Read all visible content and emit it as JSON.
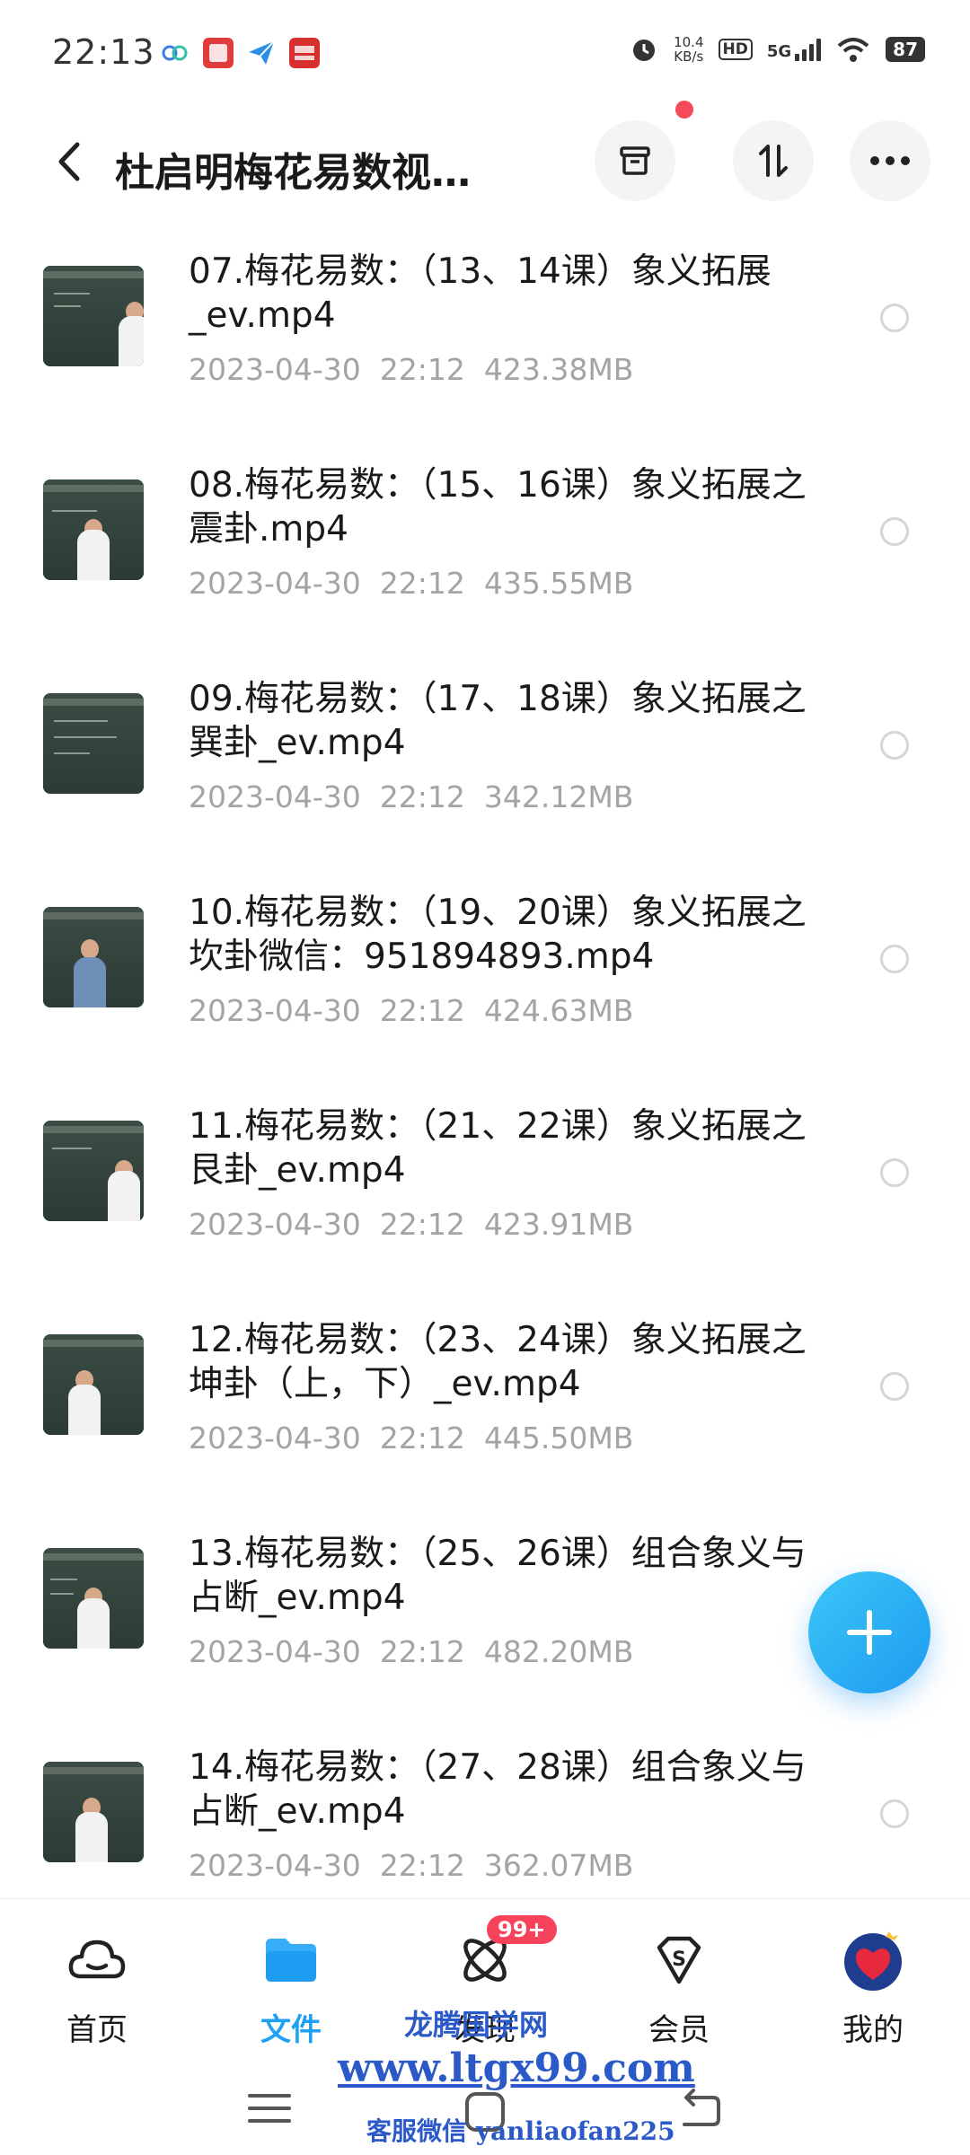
{
  "status_bar": {
    "time": "22:13",
    "speed_value": "10.4",
    "speed_unit": "KB/s",
    "hd": "HD",
    "network": "5G",
    "battery": "87"
  },
  "header": {
    "title": "杜启明梅花易数视…",
    "back_icon": "back-arrow-icon",
    "icons": [
      "archive-icon",
      "sort-icon",
      "more-icon"
    ]
  },
  "files": [
    {
      "name": "07.梅花易数：（13、14课）象义拓展_ev.mp4",
      "date": "2023-04-30",
      "time": "22:12",
      "size": "423.38MB"
    },
    {
      "name": "08.梅花易数：（15、16课）象义拓展之震卦.mp4",
      "date": "2023-04-30",
      "time": "22:12",
      "size": "435.55MB"
    },
    {
      "name": "09.梅花易数：（17、18课）象义拓展之巽卦_ev.mp4",
      "date": "2023-04-30",
      "time": "22:12",
      "size": "342.12MB"
    },
    {
      "name": "10.梅花易数：（19、20课）象义拓展之坎卦微信：951894893.mp4",
      "date": "2023-04-30",
      "time": "22:12",
      "size": "424.63MB"
    },
    {
      "name": "11.梅花易数：（21、22课）象义拓展之艮卦_ev.mp4",
      "date": "2023-04-30",
      "time": "22:12",
      "size": "423.91MB"
    },
    {
      "name": "12.梅花易数：（23、24课）象义拓展之坤卦（上，下）_ev.mp4",
      "date": "2023-04-30",
      "time": "22:12",
      "size": "445.50MB"
    },
    {
      "name": "13.梅花易数：（25、26课）组合象义与占断_ev.mp4",
      "date": "2023-04-30",
      "time": "22:12",
      "size": "482.20MB"
    },
    {
      "name": "14.梅花易数：（27、28课）组合象义与占断_ev.mp4",
      "date": "2023-04-30",
      "time": "22:12",
      "size": "362.07MB"
    }
  ],
  "fab": {
    "icon": "plus-icon"
  },
  "nav": {
    "home": "首页",
    "files": "文件",
    "discover": "发现",
    "discover_badge": "99+",
    "member": "会员",
    "mine": "我的"
  },
  "watermark": {
    "line1": "龙腾国学网",
    "line2": "www.ltgx99.com",
    "line3": "客服微信 yanliaofan225"
  },
  "colors": {
    "accent": "#1ea0f5",
    "badge": "#f6425b",
    "meta_text": "#a3a3a8",
    "watermark": "#2b5ac8"
  }
}
